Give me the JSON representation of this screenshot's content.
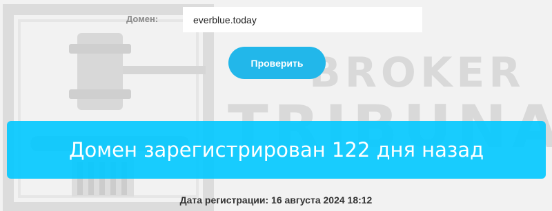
{
  "form": {
    "domain_label": "Домен:",
    "domain_value": "everblue.today",
    "check_button_label": "Проверить"
  },
  "watermark": {
    "line1": "BROKER",
    "line2": "TRIBUNAL"
  },
  "result": {
    "message": "Домен зарегистрирован 122 дня назад",
    "registration_date": "Дата регистрации: 16 августа 2024 18:12"
  },
  "colors": {
    "button": "#22b7ea",
    "banner": "#00c8ff",
    "background": "#f2f2f2"
  }
}
